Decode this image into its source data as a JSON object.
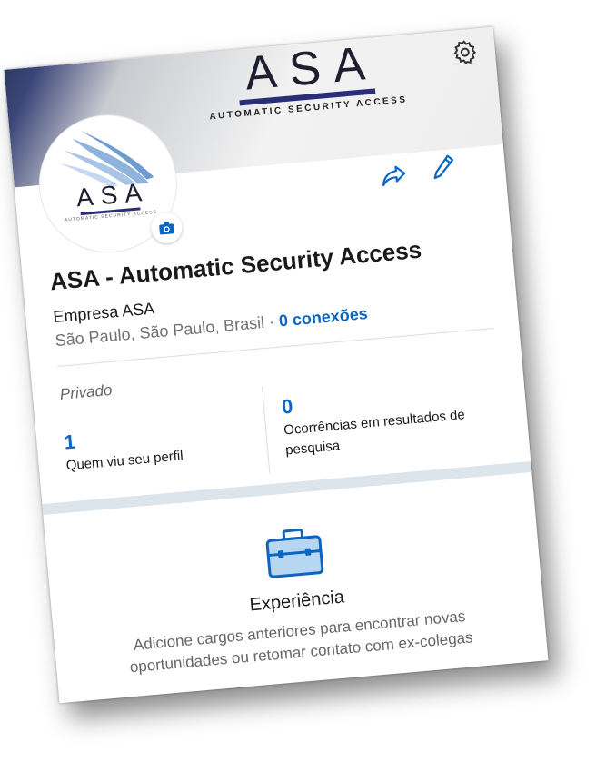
{
  "banner": {
    "logo_text": "ASA",
    "logo_subtitle": "AUTOMATIC SECURITY ACCESS"
  },
  "avatar": {
    "logo_text": "ASA",
    "logo_subtitle": "AUTOMATIC SECURITY ACCESS"
  },
  "profile": {
    "name": "ASA - Automatic Security Access",
    "headline": "Empresa ASA",
    "location": "São Paulo, São Paulo, Brasil",
    "separator": " · ",
    "connections": "0 conexões"
  },
  "stats": {
    "privacy_label": "Privado",
    "profile_views": {
      "value": "1",
      "label": "Quem viu seu perfil"
    },
    "search_appearances": {
      "value": "0",
      "label": "Ocorrências em resultados de pesquisa"
    }
  },
  "experience": {
    "title": "Experiência",
    "description": "Adicione cargos anteriores para encontrar novas oportunidades ou retomar contato com ex-colegas"
  },
  "icons": [
    "gear-icon",
    "camera-icon",
    "share-icon",
    "edit-pencil-icon",
    "briefcase-icon"
  ],
  "colors": {
    "accent": "#0a66c2",
    "logo_dark": "#1e1e2e",
    "logo_bar": "#2a2e78",
    "band": "#dde5ec"
  }
}
